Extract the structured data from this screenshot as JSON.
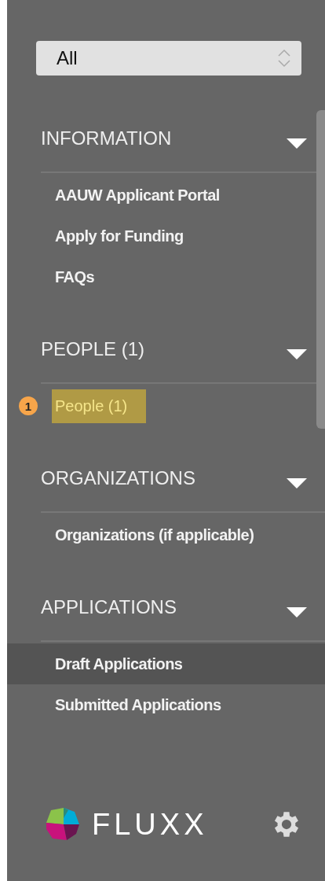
{
  "filter": {
    "value": "All"
  },
  "sections": [
    {
      "title": "INFORMATION",
      "expanded": true,
      "items": [
        {
          "label": "AAUW Applicant Portal",
          "selected": false,
          "highlighted": false
        },
        {
          "label": "Apply for Funding",
          "selected": false,
          "highlighted": false
        },
        {
          "label": "FAQs",
          "selected": false,
          "highlighted": false
        }
      ]
    },
    {
      "title": "PEOPLE (1)",
      "expanded": true,
      "items": [
        {
          "label": "People  (1)",
          "selected": false,
          "highlighted": true,
          "annotation": "1"
        }
      ]
    },
    {
      "title": "ORGANIZATIONS",
      "expanded": true,
      "items": [
        {
          "label": "Organizations (if applicable)",
          "selected": false,
          "highlighted": false
        }
      ]
    },
    {
      "title": "APPLICATIONS",
      "expanded": true,
      "items": [
        {
          "label": "Draft Applications",
          "selected": true,
          "highlighted": false
        },
        {
          "label": "Submitted Applications",
          "selected": false,
          "highlighted": false
        }
      ]
    }
  ],
  "footer": {
    "logo": "FLUXX"
  }
}
